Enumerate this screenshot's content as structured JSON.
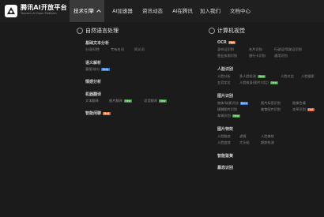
{
  "brand": {
    "name": "腾讯AI开放平台",
    "sub": "Tencent AI Open Platform"
  },
  "nav": [
    {
      "label": "技术引擎",
      "active": true
    },
    {
      "label": "AI加速器"
    },
    {
      "label": "资讯动态"
    },
    {
      "label": "AI在腾讯"
    },
    {
      "label": "加入我们"
    },
    {
      "label": "文档中心"
    }
  ],
  "badges": {
    "new": "New",
    "hot": "Hot",
    "beta": "Beta"
  },
  "left": {
    "title": "自然语言处理",
    "cats": [
      {
        "name": "基础文本分析",
        "items": [
          "分词/词性",
          "专有名词",
          "同义词"
        ]
      },
      {
        "name": "语义解析",
        "items": [
          "意图/成分"
        ]
      },
      {
        "name": "情感分析",
        "items": []
      },
      {
        "name": "机器翻译",
        "items": [
          "文本翻译",
          "图片翻译",
          "语音翻译"
        ]
      },
      {
        "name": "智能闲聊",
        "items": []
      }
    ]
  },
  "right": {
    "title": "计算机视觉",
    "cats": [
      {
        "name": "OCR",
        "items": [
          "身份证识别",
          "名片识别",
          "行驶证/驾驶证识别",
          "营业执照识别",
          "银行卡识别",
          "通用识别"
        ]
      },
      {
        "name": "人脸识别",
        "items": [
          "人脸分析",
          "多人脸检测",
          "人脸对比",
          "人脸搜索",
          "五官定位",
          "人脸核身(图片对比)"
        ]
      },
      {
        "name": "图片识别",
        "items": [
          "物体/场景识别",
          "图片标签识别",
          "图像色情",
          "模糊图片识别",
          "美食图片识别",
          "花草识别",
          "车辆识别"
        ]
      },
      {
        "name": "图片特效",
        "items": [
          "人脸融合",
          "滤镜",
          "人脸美妆",
          "人脸变妆",
          "大头贴",
          "颜龄检测"
        ]
      },
      {
        "name": "智能鉴黄",
        "items": []
      },
      {
        "name": "暴恐识别",
        "items": []
      }
    ]
  }
}
